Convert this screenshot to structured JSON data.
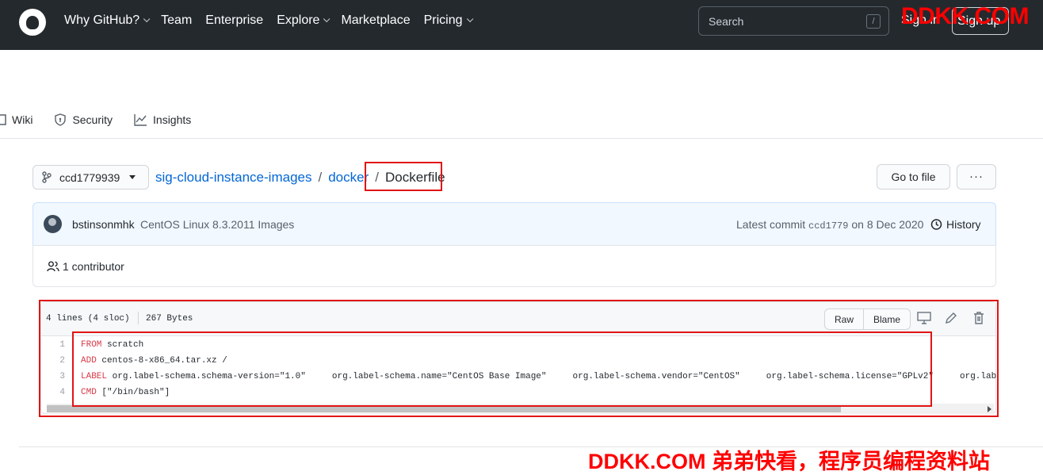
{
  "nav": {
    "items": [
      "Why GitHub?",
      "Team",
      "Enterprise",
      "Explore",
      "Marketplace",
      "Pricing"
    ],
    "search_placeholder": "Search",
    "search_key": "/",
    "sign_in": "Sign in",
    "sign_up": "Sign up"
  },
  "watermark_top": "DDKK.COM",
  "tabs": [
    "Wiki",
    "Security",
    "Insights"
  ],
  "breadcrumb": {
    "branch": "ccd1779939",
    "repo": "sig-cloud-instance-images",
    "sep": "/",
    "folder": "docker",
    "file": "Dockerfile"
  },
  "actions": {
    "goto_file": "Go to file",
    "more": "···"
  },
  "commit": {
    "author": "bstinsonmhk",
    "message": "CentOS Linux 8.3.2011 Images",
    "latest_prefix": "Latest commit",
    "hash": "ccd1779",
    "date_prefix": "on",
    "date": "8 Dec 2020",
    "history": "History"
  },
  "contributors": "1 contributor",
  "file": {
    "lines_info": "4 lines (4 sloc)",
    "size": "267 Bytes",
    "raw": "Raw",
    "blame": "Blame",
    "code": [
      {
        "num": "1",
        "kw": "FROM",
        "rest": " scratch"
      },
      {
        "num": "2",
        "kw": "ADD",
        "rest": " centos-8-x86_64.tar.xz /"
      },
      {
        "num": "3",
        "kw": "LABEL",
        "rest": " org.label-schema.schema-version=\"1.0\"     org.label-schema.name=\"CentOS Base Image\"     org.label-schema.vendor=\"CentOS\"     org.label-schema.license=\"GPLv2\"     org.lab"
      },
      {
        "num": "4",
        "kw": "CMD",
        "rest": " [\"/bin/bash\"]"
      }
    ]
  },
  "watermark_bottom": "DDKK.COM 弟弟快看，程序员编程资料站",
  "colors": {
    "header_bg": "#24292e",
    "link": "#0366d6",
    "keyword": "#d73a49",
    "annotation": "#e21414"
  }
}
